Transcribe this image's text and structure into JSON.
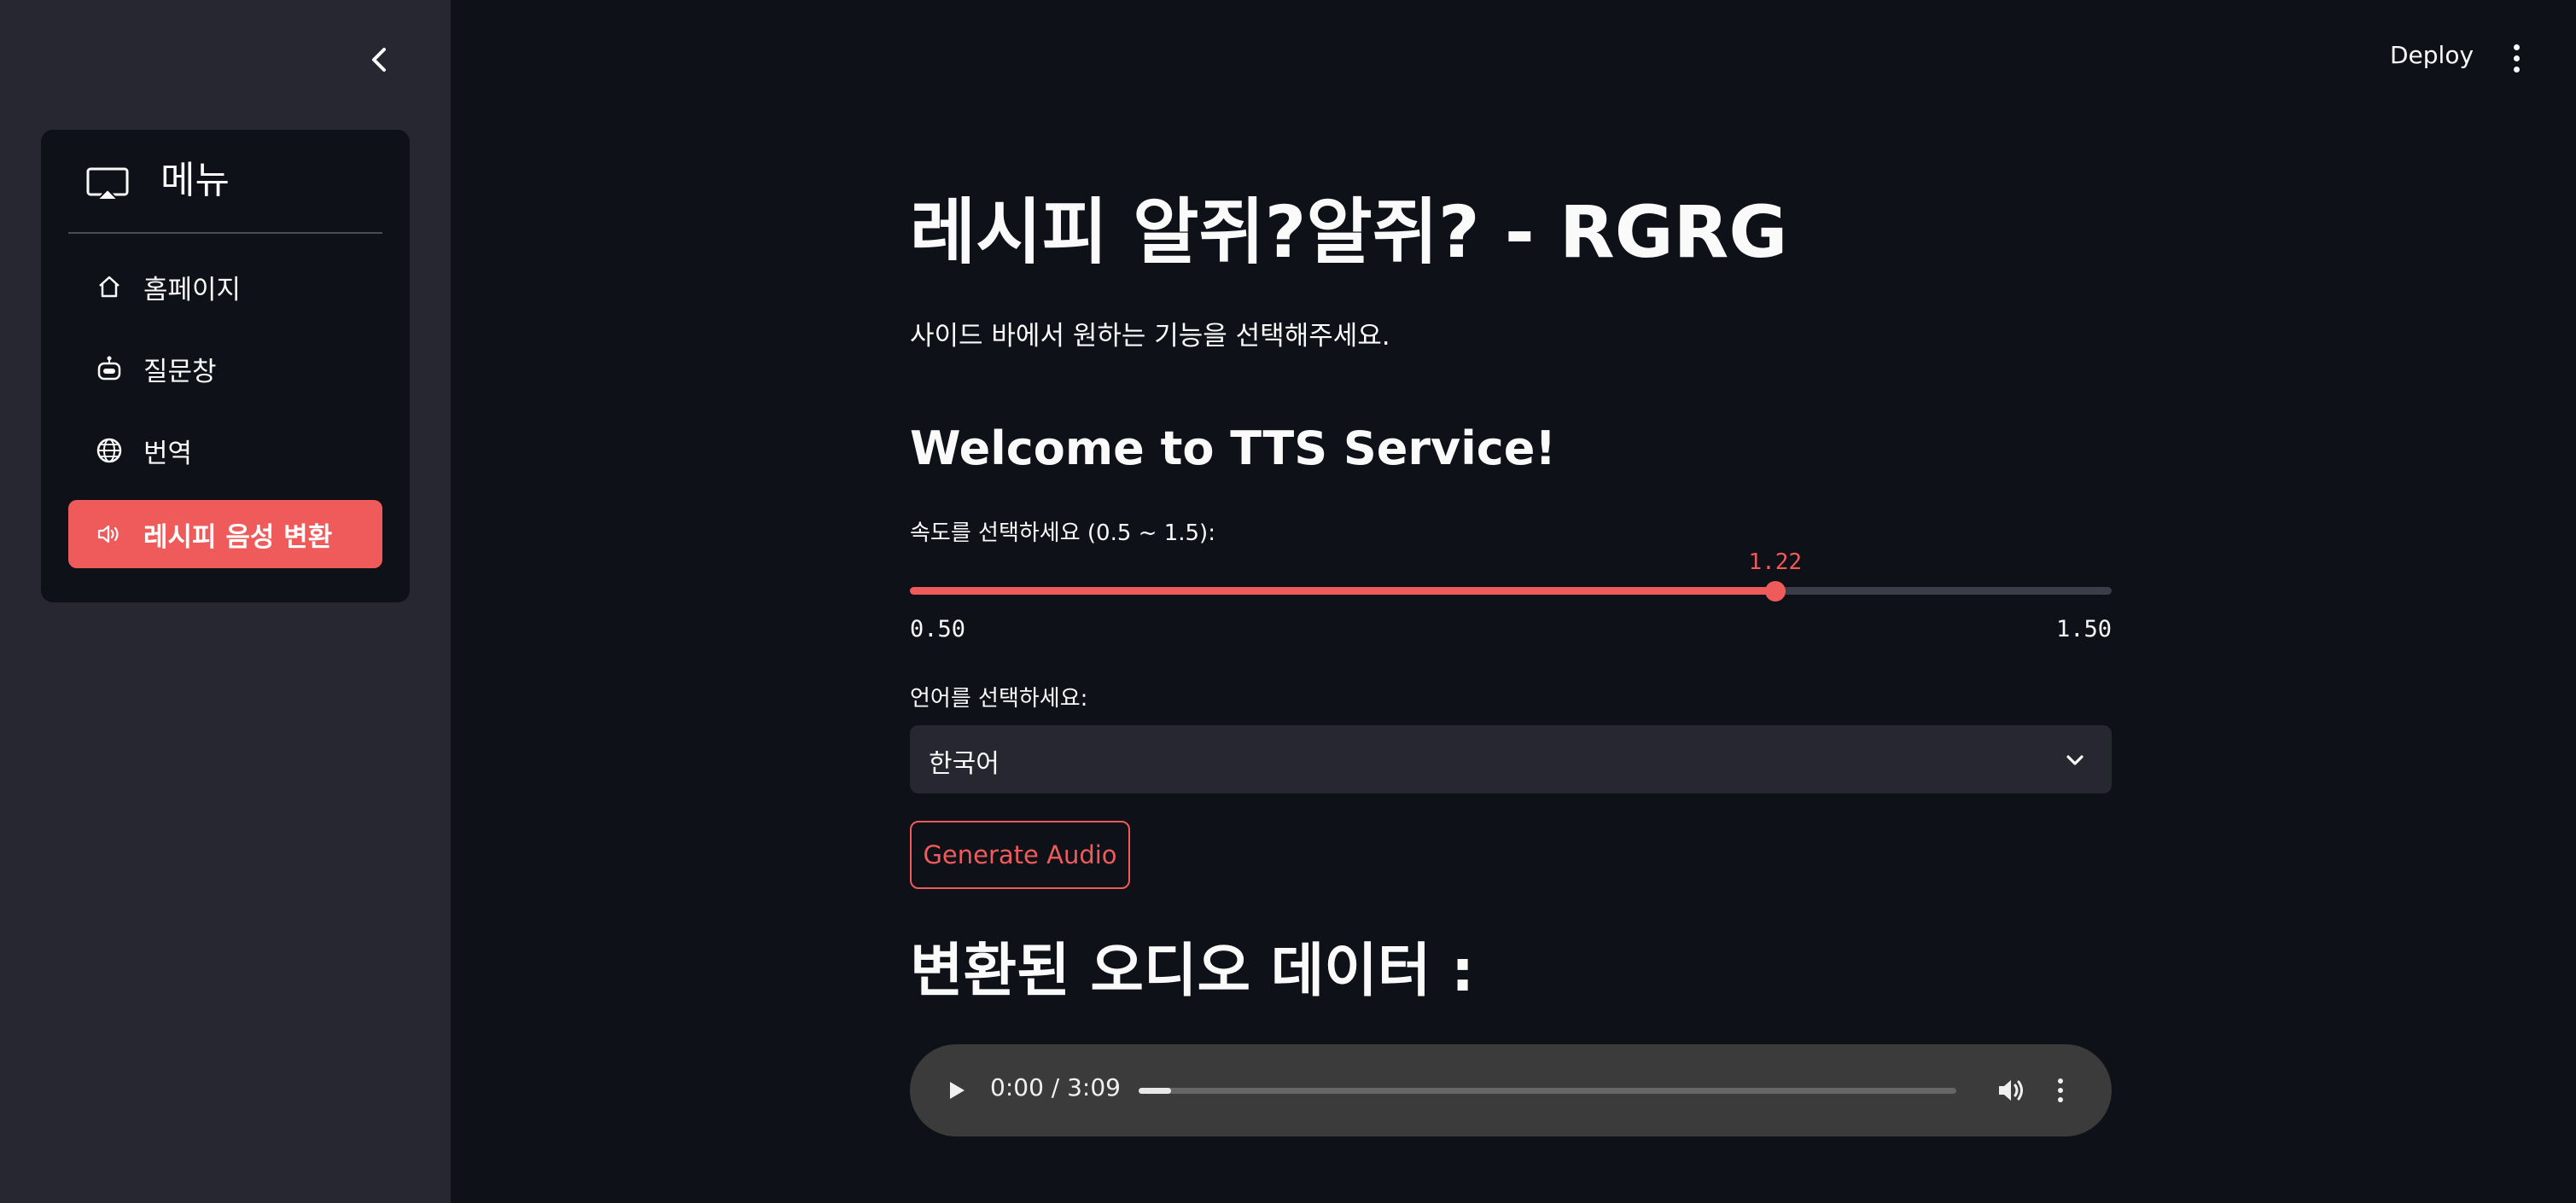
{
  "sidebar": {
    "menu_title": "메뉴",
    "items": [
      {
        "label": "홈페이지",
        "icon": "house-icon",
        "active": false
      },
      {
        "label": "질문창",
        "icon": "robot-icon",
        "active": false
      },
      {
        "label": "번역",
        "icon": "globe-icon",
        "active": false
      },
      {
        "label": "레시피 음성 변환",
        "icon": "speaker-icon",
        "active": true
      }
    ]
  },
  "topbar": {
    "deploy_label": "Deploy"
  },
  "main": {
    "title": "레시피 알쥐?알쥐? - RGRG",
    "subtitle": "사이드 바에서 원하는 기능을 선택해주세요.",
    "section_title": "Welcome to TTS Service!",
    "speed": {
      "label": "속도를 선택하세요 (0.5 ~ 1.5):",
      "value": "1.22",
      "min": "0.50",
      "max": "1.50",
      "fraction": 0.72
    },
    "language": {
      "label": "언어를 선택하세요:",
      "selected": "한국어"
    },
    "generate_label": "Generate Audio",
    "audio_title": "변환된 오디오 데이터 :",
    "audio": {
      "time": "0:00 / 3:09",
      "progress": 0.04
    }
  },
  "colors": {
    "accent": "#ef5b5b",
    "background": "#0e1117",
    "sidebar": "#262730"
  }
}
